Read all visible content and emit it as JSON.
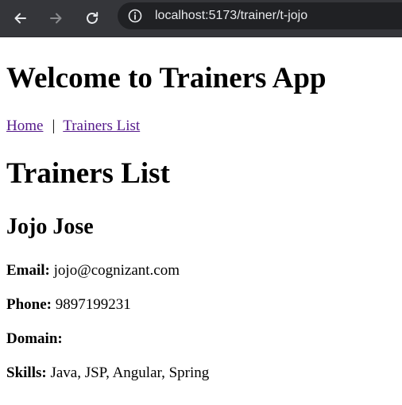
{
  "browser": {
    "url": "localhost:5173/trainer/t-jojo",
    "back_icon": "arrow-left-icon",
    "forward_icon": "arrow-right-icon",
    "reload_icon": "reload-icon",
    "info_icon": "info-circle-icon"
  },
  "page": {
    "app_title": "Welcome to Trainers App",
    "nav": {
      "home": "Home",
      "separator": "|",
      "trainers_list": "Trainers List"
    },
    "section_title": "Trainers List"
  },
  "trainer": {
    "name": "Jojo Jose",
    "email_label": "Email:",
    "email": "jojo@cognizant.com",
    "phone_label": "Phone:",
    "phone": "9897199231",
    "domain_label": "Domain:",
    "domain": "",
    "skills_label": "Skills:",
    "skills": "Java, JSP, Angular, Spring"
  },
  "colors": {
    "toolbar_bg": "#35363a",
    "address_bg": "#202124",
    "url_text": "#e8eaed",
    "visited_link": "#551a8b"
  }
}
